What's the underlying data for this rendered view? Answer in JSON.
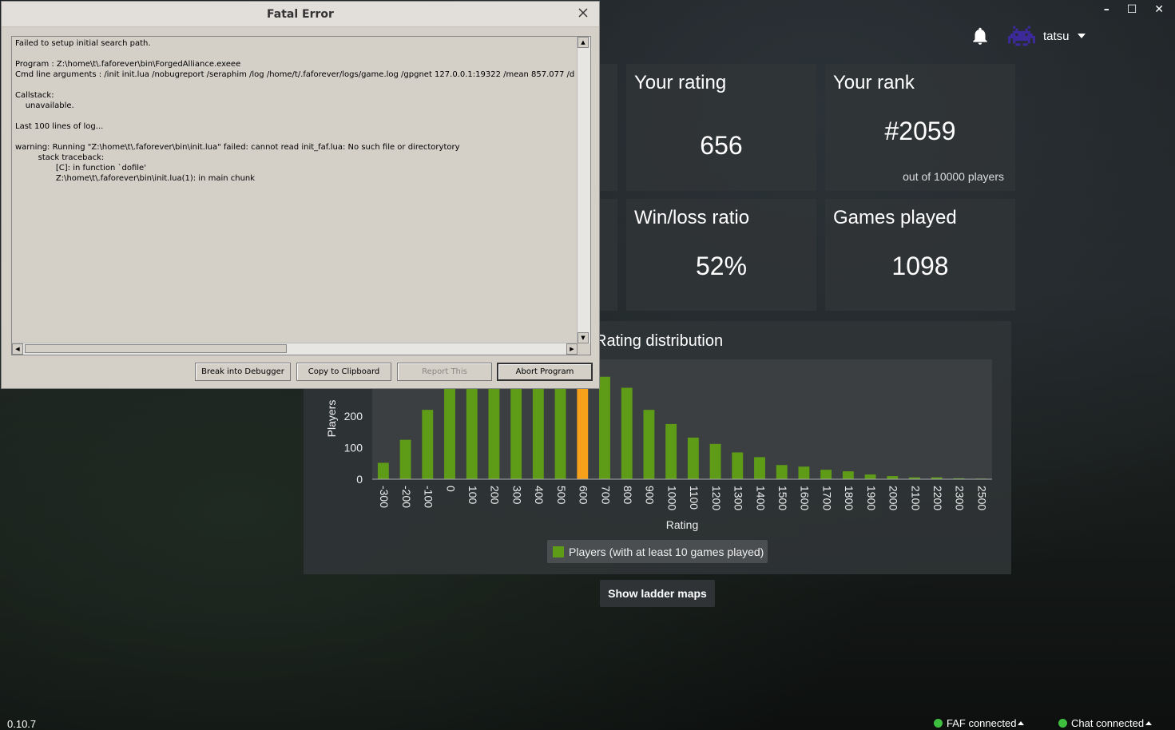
{
  "app": {
    "window_controls": [
      "–",
      "☐",
      "✕"
    ],
    "user": {
      "name": "tatsu",
      "avatar_icon": "space-invader-avatar",
      "avatar_color": "#3c2a9a"
    },
    "stats": {
      "rating": {
        "title": "Your rating",
        "value": "656"
      },
      "rank": {
        "title": "Your rank",
        "value": "#2059",
        "sub": "out of 10000 players"
      },
      "winloss": {
        "title": "Win/loss ratio",
        "value": "52%"
      },
      "games": {
        "title": "Games played",
        "value": "1098"
      }
    },
    "distribution_title": "Rating distribution",
    "legend_label": "Players (with at least 10 games played)",
    "show_ladder_maps": "Show ladder maps",
    "version": "0.10.7",
    "status": {
      "faf": "FAF connected",
      "chat": "Chat connected"
    },
    "accent_colors": {
      "bar": "#5e9c17",
      "highlight": "#f7a11a",
      "online": "#3fbf3f"
    }
  },
  "dialog": {
    "title": "Fatal Error",
    "log_lines": [
      "Failed to setup initial search path.",
      "",
      "Program : Z:\\home\\t\\.faforever\\bin\\ForgedAlliance.exeee",
      "Cmd line arguments : /init init.lua /nobugreport /seraphim /log /home/t/.faforever/logs/game.log /gpgnet 127.0.0.1:19322 /mean 857.077 /d",
      "",
      "Callstack:",
      "    unavailable.",
      "",
      "Last 100 lines of log...",
      "",
      "warning: Running \"Z:\\home\\t\\.faforever\\bin\\init.lua\" failed: cannot read init_faf.lua: No such file or directorytory",
      "         stack traceback:",
      "                [C]: in function `dofile'",
      "                Z:\\home\\t\\.faforever\\bin\\init.lua(1): in main chunk"
    ],
    "buttons": {
      "debugger": "Break into Debugger",
      "clipboard": "Copy to Clipboard",
      "report": "Report This",
      "abort": "Abort Program"
    }
  },
  "chart_data": {
    "type": "bar",
    "title": "Rating distribution",
    "xlabel": "Rating",
    "ylabel": "Players",
    "categories": [
      "-300",
      "-200",
      "-100",
      "0",
      "100",
      "200",
      "300",
      "400",
      "500",
      "600",
      "700",
      "800",
      "900",
      "1000",
      "1100",
      "1200",
      "1300",
      "1400",
      "1500",
      "1600",
      "1700",
      "1800",
      "1900",
      "2000",
      "2100",
      "2200",
      "2300",
      "2500"
    ],
    "series": [
      {
        "name": "Players (with at least 10 games played)",
        "values": [
          52,
          125,
          220,
          290,
          345,
          420,
          460,
          455,
          430,
          410,
          325,
          290,
          220,
          175,
          132,
          112,
          85,
          70,
          45,
          40,
          30,
          25,
          15,
          10,
          6,
          6,
          3,
          2
        ]
      }
    ],
    "highlight_category": "600",
    "y_ticks": [
      0,
      100,
      200,
      300
    ],
    "ylim": [
      0,
      380
    ],
    "grid": false,
    "legend_position": "bottom"
  }
}
